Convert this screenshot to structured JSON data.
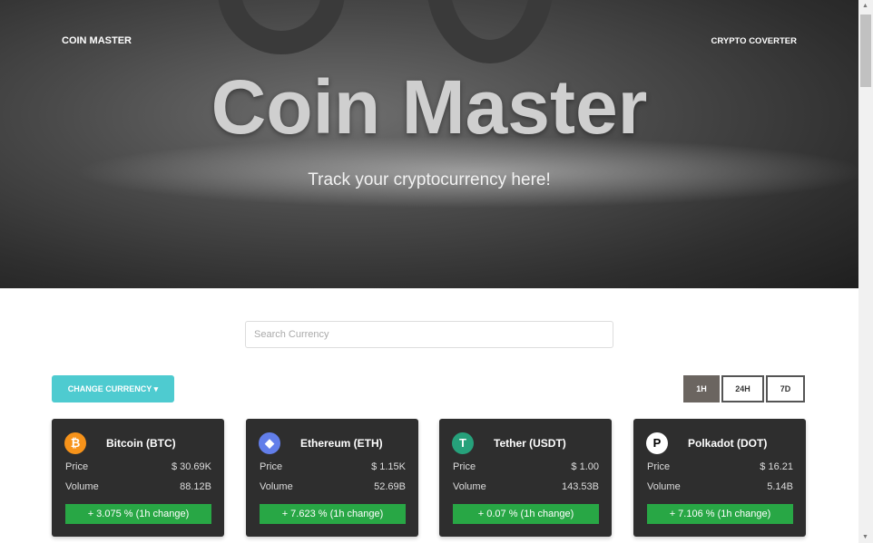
{
  "nav": {
    "brand": "COIN MASTER",
    "converter": "CRYPTO COVERTER"
  },
  "hero": {
    "title": "Coin Master",
    "subtitle": "Track your cryptocurrency here!"
  },
  "search": {
    "placeholder": "Search Currency",
    "value": ""
  },
  "change_currency": "CHANGE CURRENCY",
  "time_filters": [
    {
      "label": "1H",
      "active": true
    },
    {
      "label": "24H",
      "active": false
    },
    {
      "label": "7D",
      "active": false
    }
  ],
  "labels": {
    "price": "Price",
    "volume": "Volume"
  },
  "coins": [
    {
      "name": "Bitcoin (BTC)",
      "icon": "bitcoin-icon",
      "color": "#f7931a",
      "price": "$ 30.69K",
      "volume": "88.12B",
      "change": "+ 3.075 % (1h change)"
    },
    {
      "name": "Ethereum (ETH)",
      "icon": "ethereum-icon",
      "color": "#627eea",
      "price": "$ 1.15K",
      "volume": "52.69B",
      "change": "+ 7.623 % (1h change)"
    },
    {
      "name": "Tether (USDT)",
      "icon": "tether-icon",
      "color": "#26a17b",
      "price": "$ 1.00",
      "volume": "143.53B",
      "change": "+ 0.07 % (1h change)"
    },
    {
      "name": "Polkadot (DOT)",
      "icon": "polkadot-icon",
      "color": "#ffffff",
      "price": "$ 16.21",
      "volume": "5.14B",
      "change": "+ 7.106 % (1h change)"
    }
  ]
}
